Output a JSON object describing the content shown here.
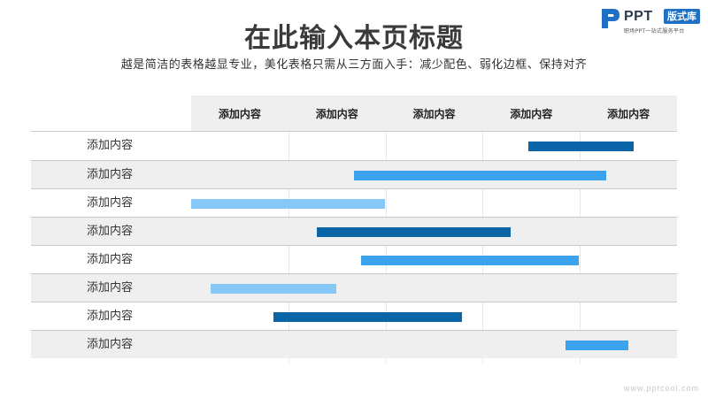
{
  "header": {
    "title": "在此输入本页标题",
    "subtitle": "越是简洁的表格越显专业，美化表格只需从三方面入手：减少配色、弱化边框、保持对齐"
  },
  "logo": {
    "text": "PPT",
    "badge": "版式库",
    "tagline": "职场PPT一站式服务平台",
    "color": "#1f6fc4"
  },
  "footer": {
    "watermark": "www.pptcool.com"
  },
  "colors": {
    "dark": "#0b63a8",
    "mid": "#3ba3ec",
    "light": "#86c8f7"
  },
  "chart_data": {
    "type": "gantt",
    "columns": [
      "添加内容",
      "添加内容",
      "添加内容",
      "添加内容",
      "添加内容"
    ],
    "x_range": [
      0,
      5
    ],
    "tasks": [
      {
        "label": "添加内容",
        "start": 3.47,
        "end": 4.55,
        "color": "dark"
      },
      {
        "label": "添加内容",
        "start": 1.68,
        "end": 4.27,
        "color": "mid"
      },
      {
        "label": "添加内容",
        "start": 0.0,
        "end": 1.99,
        "color": "light"
      },
      {
        "label": "添加内容",
        "start": 1.29,
        "end": 3.29,
        "color": "dark"
      },
      {
        "label": "添加内容",
        "start": 1.75,
        "end": 3.99,
        "color": "mid"
      },
      {
        "label": "添加内容",
        "start": 0.2,
        "end": 1.49,
        "color": "light"
      },
      {
        "label": "添加内容",
        "start": 0.85,
        "end": 2.79,
        "color": "dark"
      },
      {
        "label": "添加内容",
        "start": 3.85,
        "end": 4.5,
        "color": "mid"
      }
    ]
  }
}
